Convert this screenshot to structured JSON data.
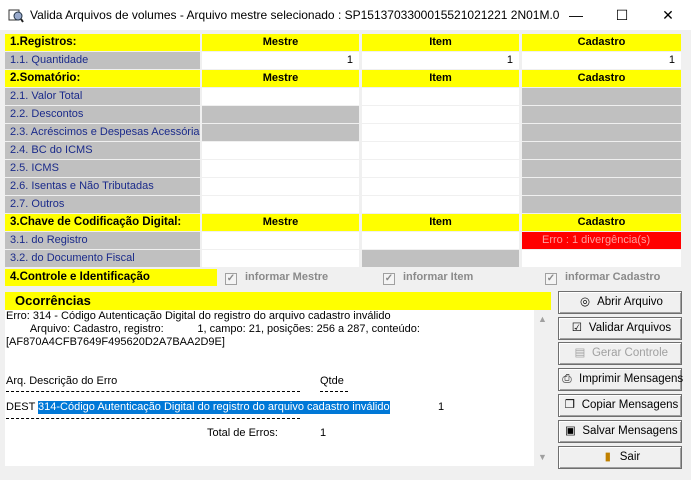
{
  "window": {
    "title": "Valida Arquivos de volumes - Arquivo mestre selecionado : SP1513703300015521021221 2N01M.00...",
    "minimize": "—",
    "maximize": "☐",
    "close": "✕"
  },
  "columns": {
    "mestre": "Mestre",
    "item": "Item",
    "cadastro": "Cadastro"
  },
  "sections": {
    "registros": {
      "title": "1.Registros:",
      "rows": [
        {
          "label": "1.1. Quantidade",
          "mestre": "1",
          "item": "1",
          "cadastro": "1"
        }
      ]
    },
    "somatorio": {
      "title": "2.Somatório:",
      "rows": [
        {
          "label": "2.1. Valor Total"
        },
        {
          "label": "2.2. Descontos"
        },
        {
          "label": "2.3. Acréscimos e Despesas Acessórias"
        },
        {
          "label": "2.4. BC do ICMS"
        },
        {
          "label": "2.5. ICMS"
        },
        {
          "label": "2.6. Isentas e Não Tributadas"
        },
        {
          "label": "2.7. Outros"
        }
      ]
    },
    "chave": {
      "title": "3.Chave de Codificação Digital:",
      "rows": [
        {
          "label": "3.1. do Registro",
          "cadastro": "Erro : 1 divergência(s)"
        },
        {
          "label": "3.2. do Documento Fiscal"
        }
      ]
    },
    "controle": {
      "title": "4.Controle e Identificação",
      "informar_mestre": "informar Mestre",
      "informar_item": "informar Item",
      "informar_cadastro": "informar Cadastro"
    }
  },
  "ocorrencias": {
    "title": "Ocorrências",
    "lines": [
      "Erro: 314 - Código Autenticação Digital do registro do arquivo cadastro inválido",
      "        Arquivo: Cadastro, registro:           1, campo: 21, posições: 256 a 287, conteúdo:",
      "[AF870A4CFB7649F495620D2A7BAA2D9E]"
    ],
    "header_arq": "Arq. Descrição do Erro",
    "header_qtde": "Qtde",
    "row_arq": "DEST",
    "row_desc": "314-Código Autenticação Digital do registro do arquivo cadastro inválido",
    "row_qtde": "1",
    "total_label": "Total de Erros:",
    "total_value": "1"
  },
  "buttons": {
    "abrir": "Abrir Arquivo",
    "validar": "Validar Arquivos",
    "gerar": "Gerar Controle",
    "imprimir": "Imprimir Mensagens",
    "copiar": "Copiar Mensagens",
    "salvar": "Salvar Mensagens",
    "sair": "Sair"
  },
  "colors": {
    "header_yellow": "#ffff00",
    "label_gray": "#c0c0c0",
    "error_red": "#ff0000",
    "selection_blue": "#0078d7"
  }
}
